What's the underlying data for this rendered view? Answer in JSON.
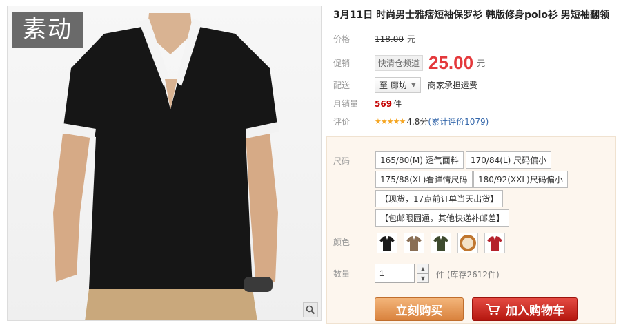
{
  "product": {
    "title": "3月11日 时尚男士雅痞短袖保罗衫 韩版修身polo衫 男短袖翻领",
    "logo_text": "素动"
  },
  "price": {
    "label": "价格",
    "original": "118.00",
    "unit": "元"
  },
  "promo": {
    "label": "促销",
    "tag": "快清仓频道",
    "price": "25.00",
    "unit": "元"
  },
  "shipping": {
    "label": "配送",
    "location": "至 廊坊",
    "note": "商家承担运费"
  },
  "monthly_sales": {
    "label": "月销量",
    "value": "569",
    "unit": "件"
  },
  "rating": {
    "label": "评价",
    "stars": "★★★★★",
    "score": "4.8分",
    "reviews": "(累计评价1079)"
  },
  "options": {
    "size_label": "尺码",
    "sizes": [
      "165/80(M) 透气面料",
      "170/84(L) 尺码偏小",
      "175/88(XL)看详情尺码",
      "180/92(XXL)尺码偏小",
      "【现货，17点前订单当天出货】",
      "【包邮限圆通，其他快递补邮差】"
    ],
    "color_label": "颜色",
    "colors": [
      "#1a1a1a",
      "#8a6f55",
      "#3d4a2e",
      "#c0762f",
      "#b5222c"
    ]
  },
  "quantity": {
    "label": "数量",
    "value": "1",
    "stock": "件 (库存2612件)"
  },
  "actions": {
    "buy_now": "立刻购买",
    "add_to_cart": "加入购物车"
  }
}
